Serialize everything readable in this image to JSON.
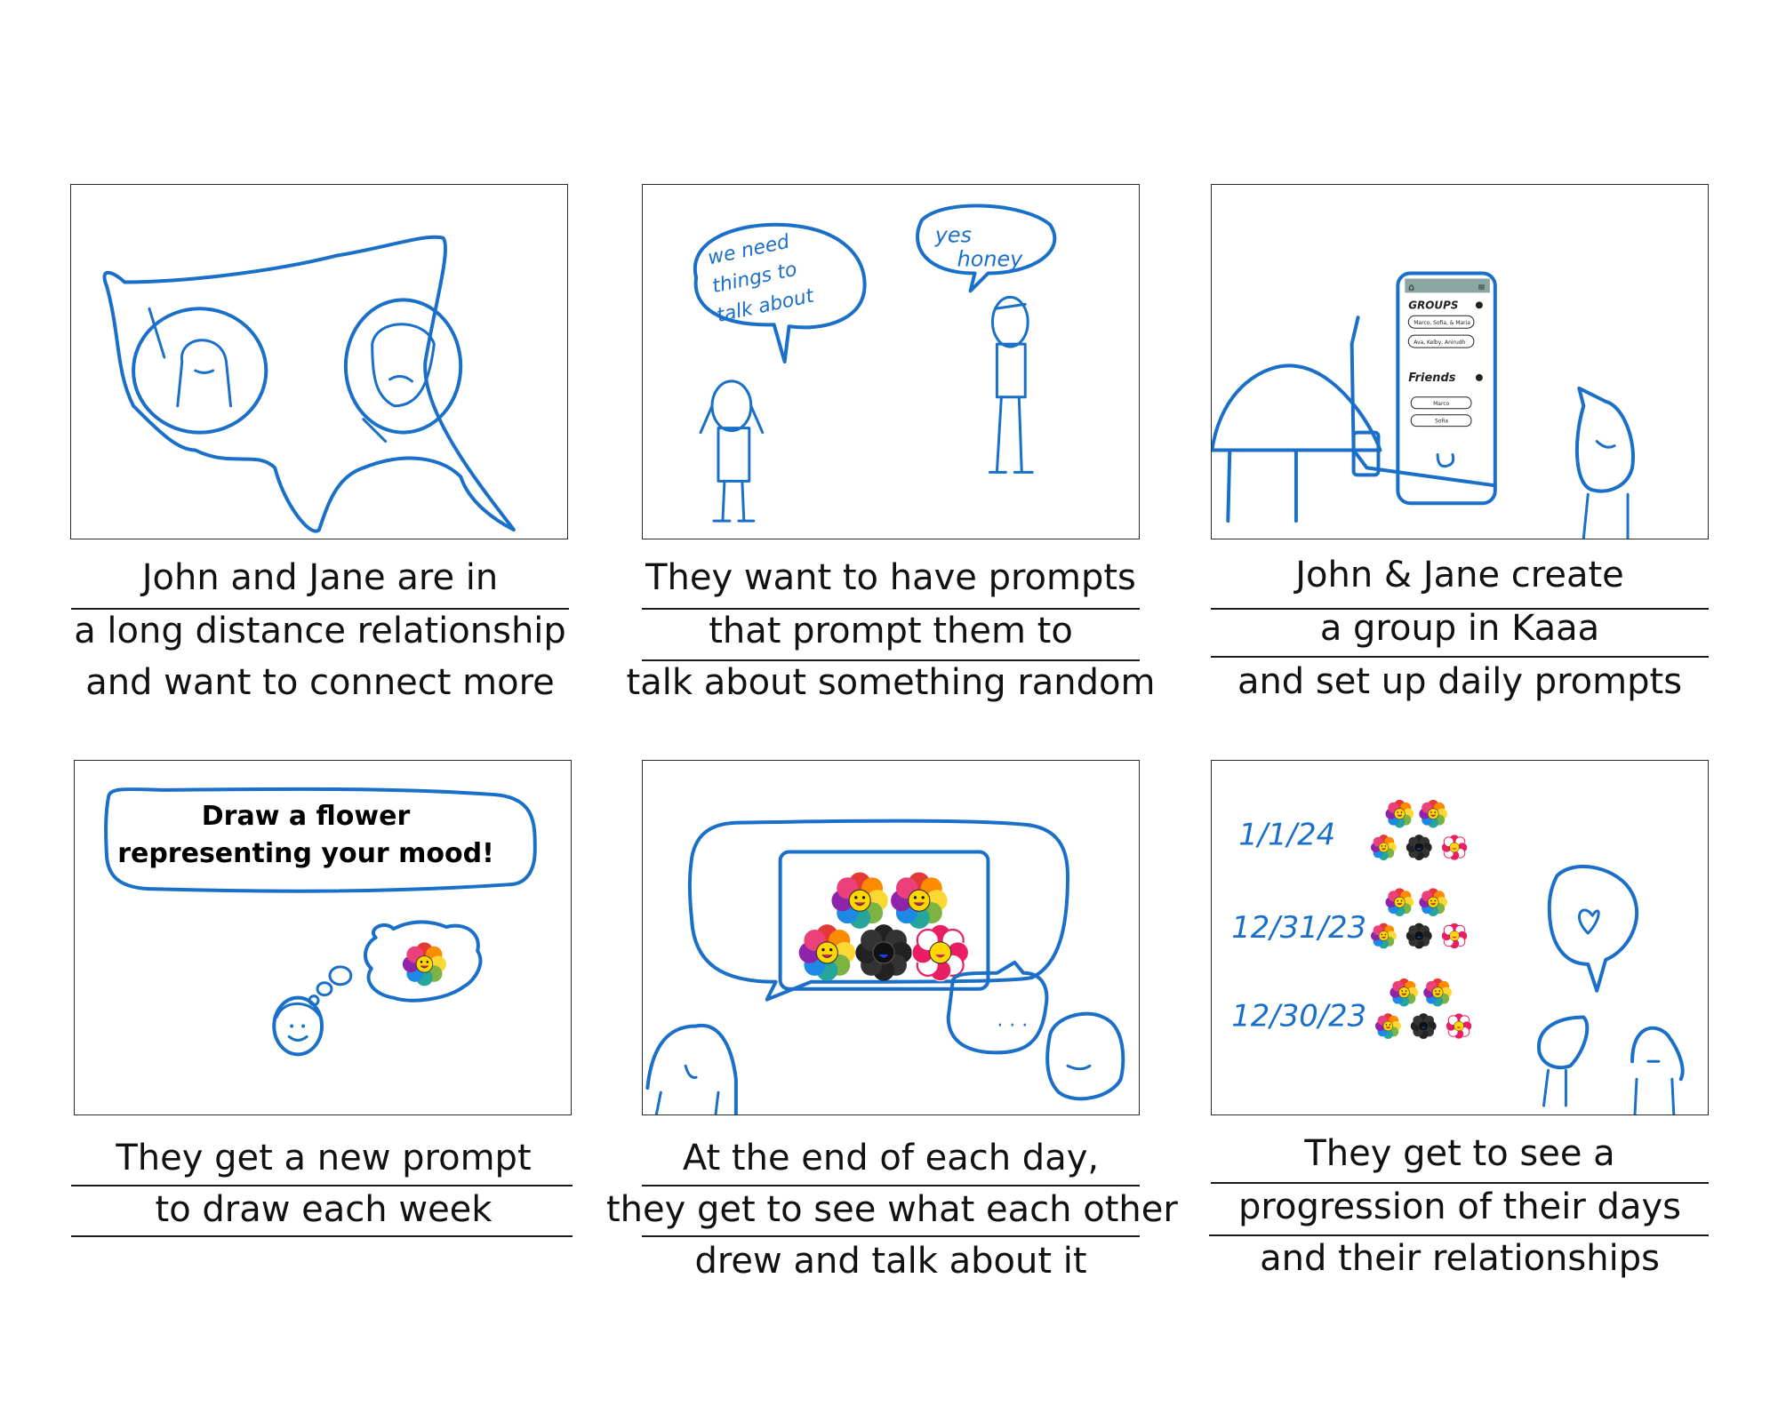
{
  "colors": {
    "ink": "#1a6fc9",
    "frame_border": "#2b2b2b",
    "caption_text": "#111111"
  },
  "panels": [
    {
      "captions": [
        "John and Jane are in",
        "a long distance relationship",
        "and want to connect more"
      ],
      "icons": [
        "map-sketch",
        "girl-portrait-icon",
        "sad-boy-portrait-icon"
      ]
    },
    {
      "captions": [
        "They want to have prompts",
        "that prompt them to",
        "talk about something random"
      ],
      "bubble_left": [
        "we need",
        "things to",
        "talk about"
      ],
      "bubble_right": [
        "yes",
        "honey"
      ]
    },
    {
      "captions": [
        "John & Jane create",
        "a group in Kaaa",
        "and set up daily prompts"
      ],
      "phone": {
        "groups_label": "GROUPS",
        "group_items": [
          "Marco, Sofia, & Maria",
          "Ava, Kelby, Anirudh"
        ],
        "friends_label": "Friends",
        "friend_items": [
          "Marco",
          "Sofia"
        ]
      }
    },
    {
      "captions": [
        "They get a new prompt",
        "to draw each week"
      ],
      "prompt_text": "Draw a flower representing your mood!"
    },
    {
      "captions": [
        "At the end of each day,",
        "they get to see what each other",
        "drew and talk about it"
      ],
      "ellipsis": ". . ."
    },
    {
      "captions": [
        "They get to see a",
        "progression of their days",
        "and their relationships"
      ],
      "dates": [
        "1/1/24",
        "12/31/23",
        "12/30/23"
      ]
    }
  ]
}
